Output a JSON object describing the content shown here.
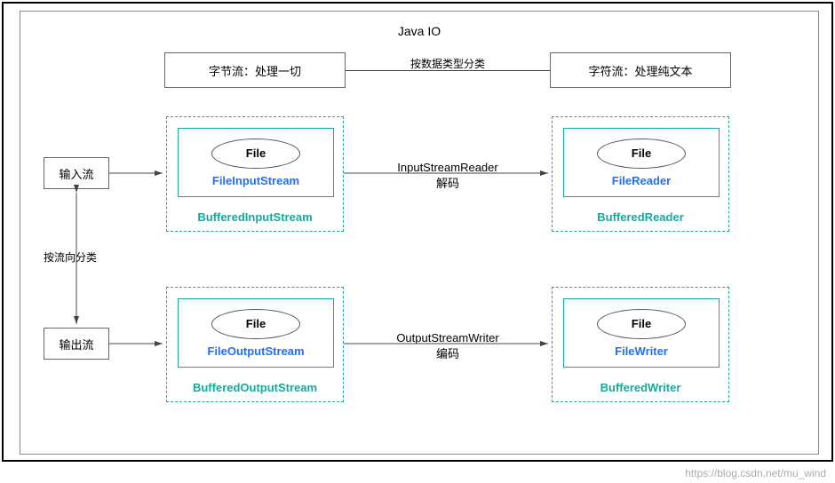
{
  "title": "Java IO",
  "topRow": {
    "byteStream": "字节流：处理一切",
    "charStream": "字符流：处理纯文本",
    "connectorLabel": "按数据类型分类"
  },
  "side": {
    "input": "输入流",
    "output": "输出流",
    "directionLabel": "按流向分类"
  },
  "groups": {
    "inByte": {
      "file": "File",
      "stream": "FileInputStream",
      "buffered": "BufferedInputStream"
    },
    "inChar": {
      "file": "File",
      "stream": "FileReader",
      "buffered": "BufferedReader"
    },
    "outByte": {
      "file": "File",
      "stream": "FileOutputStream",
      "buffered": "BufferedOutputStream"
    },
    "outChar": {
      "file": "File",
      "stream": "FileWriter",
      "buffered": "BufferedWriter"
    }
  },
  "midArrows": {
    "inLabel1": "InputStreamReader",
    "inLabel2": "解码",
    "outLabel1": "OutputStreamWriter",
    "outLabel2": "编码"
  },
  "watermark": "https://blog.csdn.net/mu_wind"
}
